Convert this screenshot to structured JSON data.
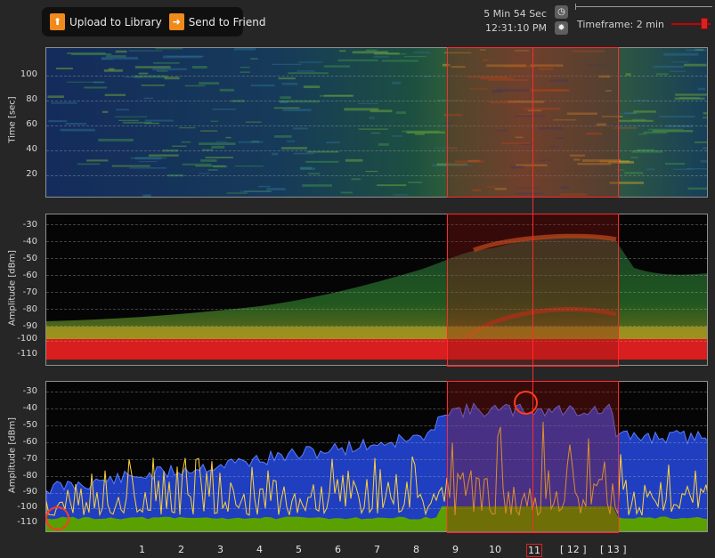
{
  "toolbar": {
    "upload_label": "Upload to Library",
    "send_label": "Send to Friend"
  },
  "clock": {
    "duration": "5 Min 54 Sec",
    "time": "12:31:10 PM"
  },
  "timeframe": {
    "label": "Timeframe: 2 min",
    "level": 0.8
  },
  "waterfall": {
    "axis_title": "Time [sec]",
    "ticks": [
      "100",
      "80",
      "60",
      "40",
      "20"
    ]
  },
  "density": {
    "axis_title": "Amplitude [dBm]",
    "ticks": [
      "-30",
      "-40",
      "-50",
      "-60",
      "-70",
      "-80",
      "-90",
      "-100",
      "-110"
    ]
  },
  "spectrum": {
    "axis_title": "Amplitude [dBm]",
    "ticks": [
      "-30",
      "-40",
      "-50",
      "-60",
      "-70",
      "-80",
      "-90",
      "-100",
      "-110"
    ]
  },
  "x_axis": {
    "labels": [
      "1",
      "2",
      "3",
      "4",
      "5",
      "6",
      "7",
      "8",
      "9",
      "10",
      "11",
      "[ 12 ]",
      "[ 13 ]"
    ],
    "cursor_index": 10
  },
  "colors": {
    "accent": "#ff2a2a",
    "max_hold": "#1f3fc0",
    "average": "#5aa000",
    "current": "#ffd23a"
  }
}
